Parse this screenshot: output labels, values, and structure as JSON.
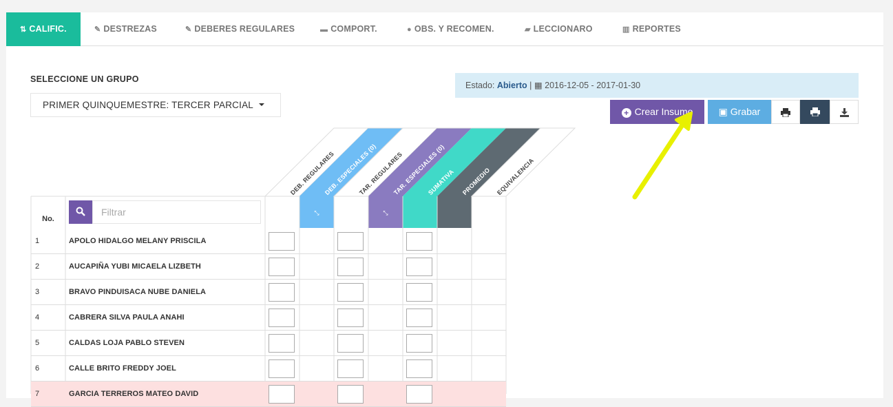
{
  "tabs": [
    {
      "label": "CALIFIC.",
      "icon": "sort-icon",
      "active": true
    },
    {
      "label": "DESTREZAS",
      "icon": "edit-icon"
    },
    {
      "label": "DEBERES REGULARES",
      "icon": "edit-icon"
    },
    {
      "label": "COMPORT.",
      "icon": "comment-icon"
    },
    {
      "label": "OBS. Y RECOMEN.",
      "icon": "comments-icon"
    },
    {
      "label": "LECCIONARO",
      "icon": "book-icon"
    },
    {
      "label": "REPORTES",
      "icon": "bar-chart-icon"
    }
  ],
  "group": {
    "label": "SELECCIONE UN GRUPO",
    "selected": "PRIMER QUINQUEMESTRE: TERCER PARCIAL"
  },
  "status": {
    "prefix": "Estado:",
    "state": "Abierto",
    "separator": "|",
    "dates": "2016-12-05 - 2017-01-30"
  },
  "buttons": {
    "crear": "Crear Insumo",
    "grabar": "Grabar"
  },
  "colors": {
    "teal": "#1abc9c",
    "purple": "#7057a8",
    "lightblue": "#5dade2",
    "turquoise": "#40d9c8",
    "gray": "#5e6a72",
    "alert_row": "#fde0e0"
  },
  "table": {
    "no_header": "No.",
    "filter_placeholder": "Filtrar",
    "columns": [
      {
        "label": "DEB. REGULARES",
        "style": "plain"
      },
      {
        "label": "DEB. ESPECIALES (0)",
        "style": "blue"
      },
      {
        "label": "TAR. REGULARES",
        "style": "plain"
      },
      {
        "label": "TAR. ESPECIALES (0)",
        "style": "purple"
      },
      {
        "label": "SUMATIVA",
        "style": "turquoise"
      },
      {
        "label": "PROMEDIO",
        "style": "gray"
      },
      {
        "label": "EQUIVALENCIA",
        "style": "plain"
      }
    ],
    "rows": [
      {
        "num": "1",
        "name": "APOLO HIDALGO MELANY PRISCILA"
      },
      {
        "num": "2",
        "name": "AUCAPIÑA YUBI MICAELA LIZBETH"
      },
      {
        "num": "3",
        "name": "BRAVO PINDUISACA NUBE DANIELA"
      },
      {
        "num": "4",
        "name": "CABRERA SILVA PAULA ANAHI"
      },
      {
        "num": "5",
        "name": "CALDAS LOJA PABLO STEVEN"
      },
      {
        "num": "6",
        "name": "CALLE BRITO FREDDY JOEL"
      },
      {
        "num": "7",
        "name": "GARCIA TERREROS MATEO DAVID",
        "alert": true
      }
    ]
  }
}
